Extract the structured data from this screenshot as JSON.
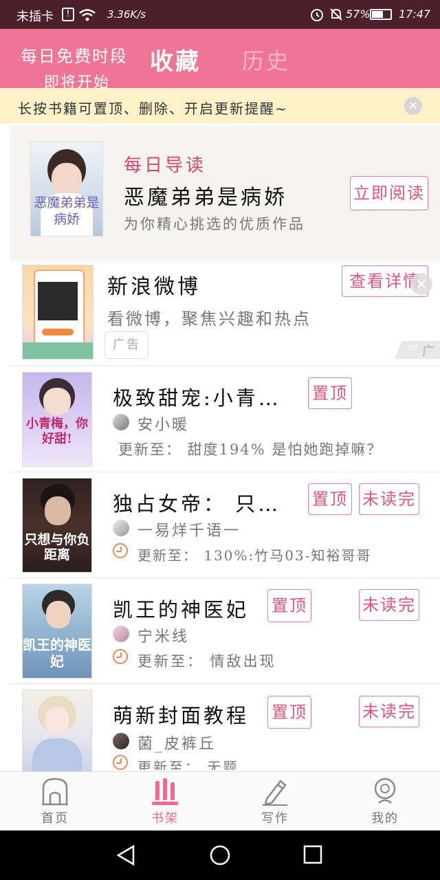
{
  "status_bar": {
    "carrier": "未插卡",
    "speed": "3.36K/s",
    "battery_percent": "57%",
    "time": "17:47"
  },
  "header": {
    "promo_line1": "每日免费时段",
    "promo_line2": "即将开始",
    "tab_favorites": "收藏",
    "tab_history": "历史",
    "bg_color": "#f07496"
  },
  "tip": {
    "text": "长按书籍可置顶、删除、开启更新提醒~"
  },
  "daily_pick": {
    "label": "每日导读",
    "title": "恶魔弟弟是病娇",
    "subtitle": "为你精心挑选的优质作品",
    "button": "立即阅读",
    "cover_text": "恶魔弟弟是病娇"
  },
  "ad": {
    "title": "新浪微博",
    "desc": "看微博，聚焦兴趣和热点",
    "badge": "广告",
    "button": "查看详情",
    "corner_label": "广告"
  },
  "books": [
    {
      "title": "极致甜宠:小青…",
      "author": "安小暖",
      "update": "更新至： 甜度194% 是怕她跑掉嘛？",
      "pin_label": "置顶",
      "unread_label": "",
      "cover_text": "小青梅，你好甜!"
    },
    {
      "title": "独占女帝： 只…",
      "author": "一易烊千语一",
      "update": "更新至： 130%:竹马03-知裕哥哥",
      "pin_label": "置顶",
      "unread_label": "未读完",
      "cover_text": "只想与你负距离"
    },
    {
      "title": "凯王的神医妃",
      "author": "宁米线",
      "update": "更新至： 情敌出现",
      "pin_label": "置顶",
      "unread_label": "未读完",
      "cover_text": "凯王的神医妃"
    },
    {
      "title": "萌新封面教程",
      "author": "菌_皮裤丘",
      "update": "更新至： 无题",
      "pin_label": "置顶",
      "unread_label": "未读完",
      "cover_text": ""
    }
  ],
  "tabbar": {
    "items": [
      {
        "label": "首页",
        "icon": "home-icon"
      },
      {
        "label": "书架",
        "icon": "bookshelf-icon"
      },
      {
        "label": "写作",
        "icon": "pencil-icon"
      },
      {
        "label": "我的",
        "icon": "profile-icon"
      }
    ],
    "active_color": "#f06a8d"
  }
}
